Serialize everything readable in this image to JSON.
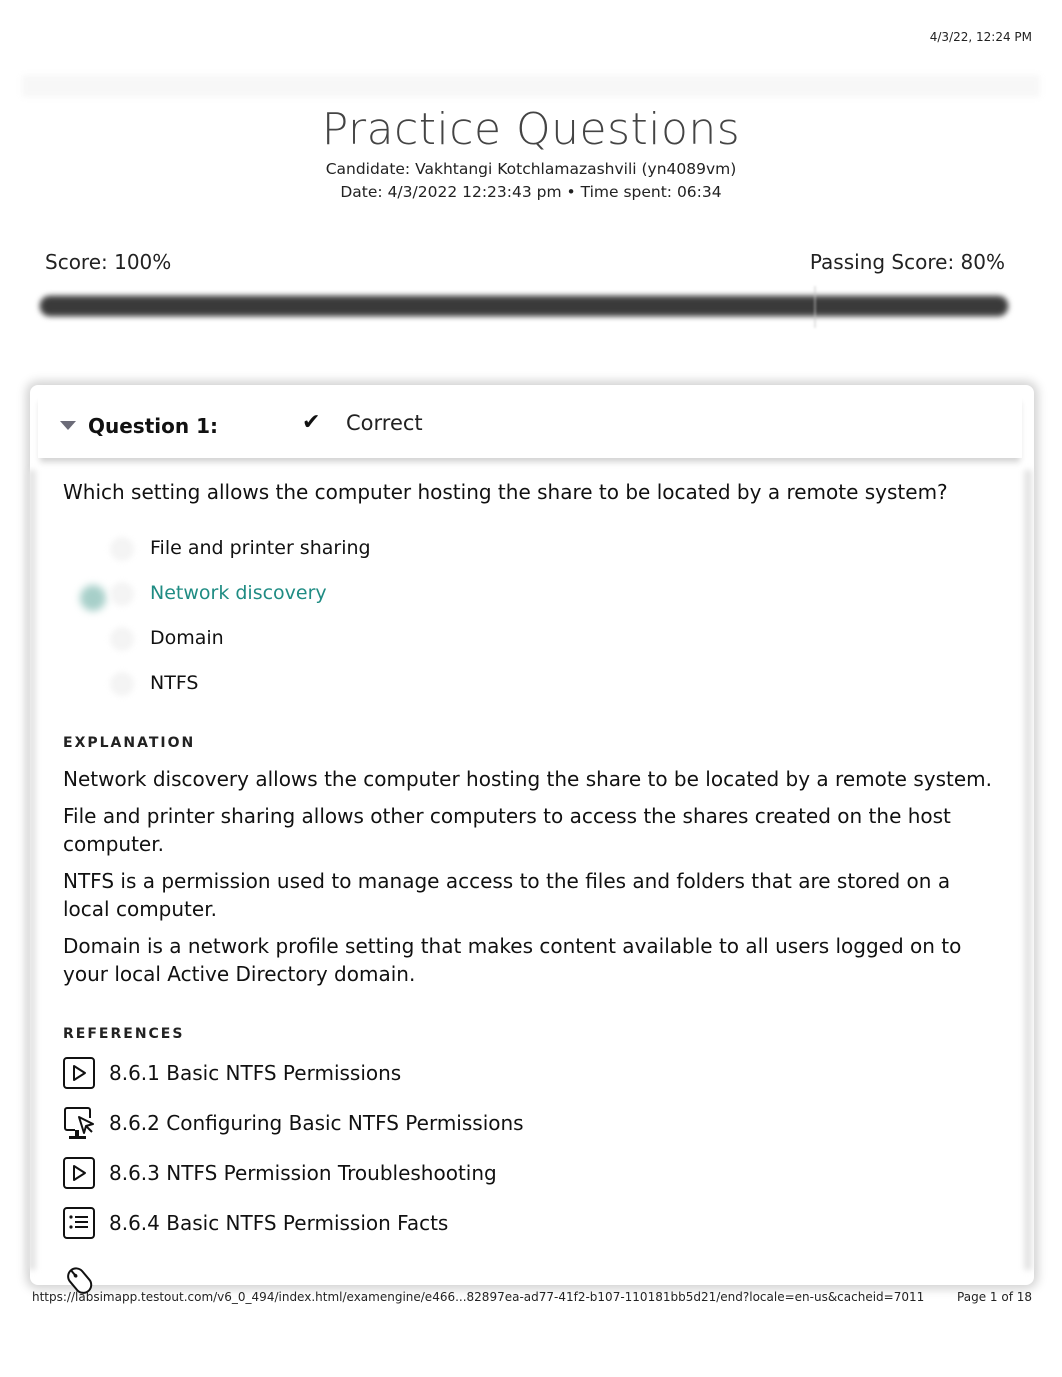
{
  "print_header": {
    "date": "4/3/22, 12:24 PM"
  },
  "page": {
    "title": "Practice Questions",
    "candidate": "Candidate: Vakhtangi Kotchlamazashvili  (yn4089vm)",
    "date_line": "Date: 4/3/2022 12:23:43 pm • Time spent: 06:34"
  },
  "score": {
    "label": "Score: 100%",
    "passing_label": "Passing Score: 80%",
    "value_percent": 100,
    "passing_percent": 80
  },
  "question": {
    "label": "Question 1:",
    "status_icon": "checkmark-icon",
    "status": "Correct",
    "text": "Which setting allows the computer hosting the share to be located by a remote system?",
    "options": [
      {
        "label": "File and printer sharing",
        "selected": false,
        "correct": false
      },
      {
        "label": "Network discovery",
        "selected": true,
        "correct": true
      },
      {
        "label": "Domain",
        "selected": false,
        "correct": false
      },
      {
        "label": "NTFS",
        "selected": false,
        "correct": false
      }
    ],
    "explanation_heading": "EXPLANATION",
    "explanation": [
      "Network discovery allows the computer hosting the share to be located by a remote system.",
      "File and printer sharing allows other computers to access the shares created on the host computer.",
      "NTFS is a permission used to manage access to the files and folders that are stored on a local computer.",
      "Domain is a network profile setting that makes content available to all users logged on to your local Active Directory domain."
    ],
    "references_heading": "REFERENCES",
    "references": [
      {
        "icon": "video-play-icon",
        "label": "8.6.1 Basic NTFS Permissions"
      },
      {
        "icon": "lab-simulation-icon",
        "label": "8.6.2 Configuring Basic NTFS Permissions"
      },
      {
        "icon": "video-play-icon",
        "label": "8.6.3 NTFS Permission Troubleshooting"
      },
      {
        "icon": "fact-sheet-icon",
        "label": "8.6.4 Basic NTFS Permission Facts"
      }
    ]
  },
  "footer": {
    "url": "https://labsimapp.testout.com/v6_0_494/index.html/examengine/e466...82897ea-ad77-41f2-b107-110181bb5d21/end?locale=en-us&cacheid=7011",
    "page": "Page 1 of 18"
  },
  "colors": {
    "correct_answer": "#1f8c83",
    "score_bar": "#3a3a3a"
  }
}
